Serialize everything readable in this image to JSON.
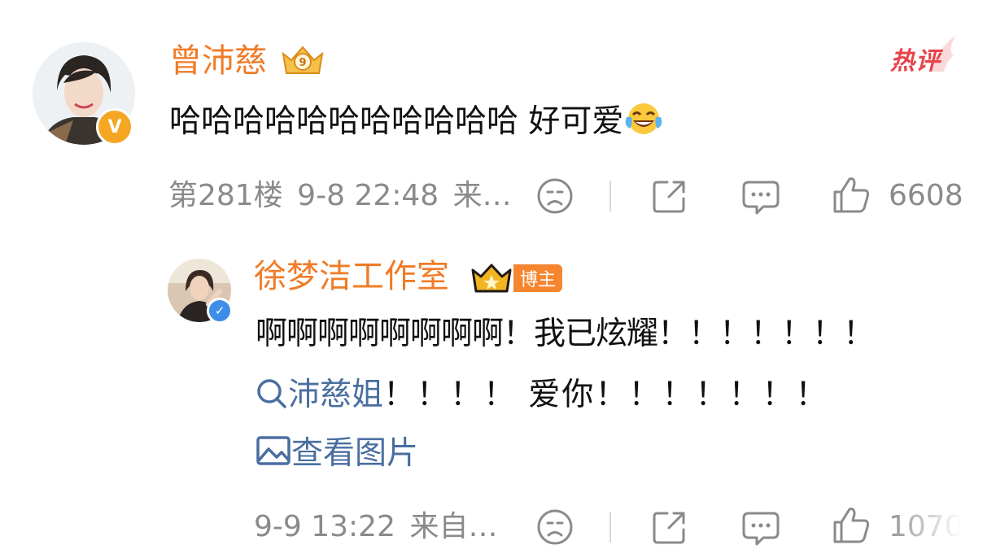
{
  "comment": {
    "author": "曾沛慈",
    "text": "哈哈哈哈哈哈哈哈哈哈哈 好可爱",
    "emoji_icon": "laugh-crying-emoji-icon",
    "hot_label": "热评",
    "floor": "第281楼",
    "time": "9-8 22:48",
    "source": "来…",
    "likes": "6608",
    "verified_color": "#f5a623"
  },
  "reply": {
    "author": "徐梦洁工作室",
    "badge": "博主",
    "line1": "啊啊啊啊啊啊啊啊！我已炫耀！！！！！！！",
    "mention": "沛慈姐",
    "line2_rest": "！！！！ 爱你！！！！！！！",
    "view_image": "查看图片",
    "time": "9-9 13:22",
    "source": "来自…",
    "likes": "1070",
    "verified_color": "#3d8ee8"
  },
  "colors": {
    "name": "#f07b27",
    "link": "#4a6ea0",
    "meta": "#8a8a8a",
    "hot": "#e8434b"
  }
}
